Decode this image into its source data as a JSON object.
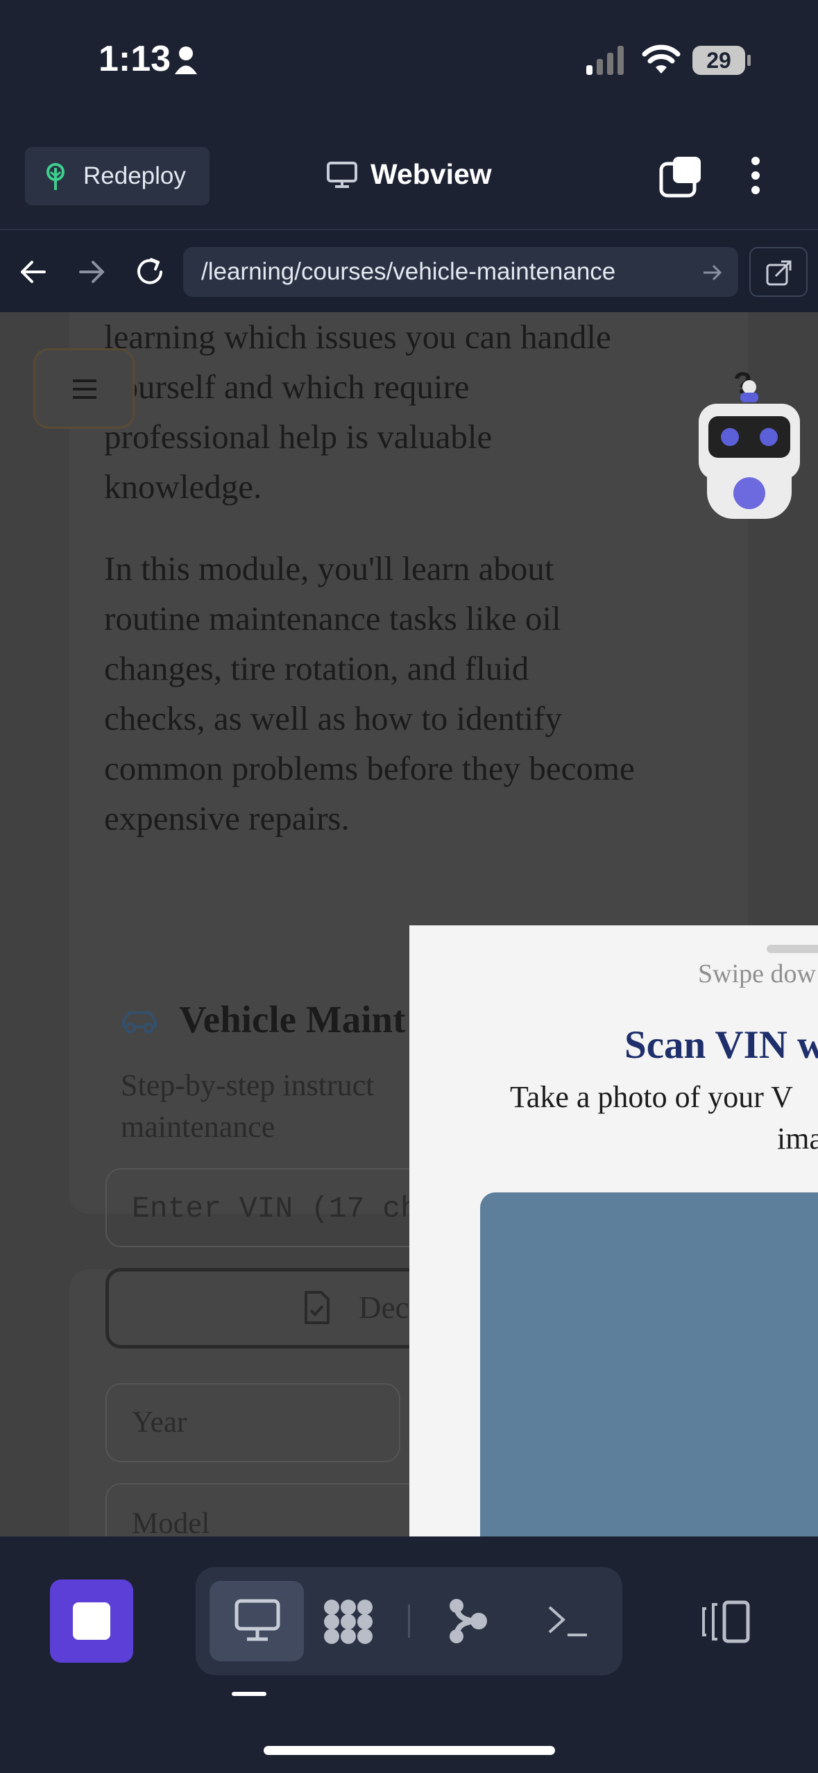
{
  "status_bar": {
    "time": "1:13",
    "battery": "29"
  },
  "header": {
    "redeploy_label": "Redeploy",
    "title": "Webview"
  },
  "url_bar": {
    "url": "/learning/courses/vehicle-maintenance"
  },
  "content": {
    "para1_lines": [
      "learning which issues you can handle",
      "yourself and which require",
      "professional help is valuable",
      "knowledge."
    ],
    "para2_lines": [
      "In this module, you'll learn about",
      "routine maintenance tasks like oil",
      "changes, tire rotation, and fluid",
      "checks, as well as how to identify",
      "common problems before they become",
      "expensive repairs."
    ],
    "help_glyph": "?",
    "tool_title": "Vehicle Maint",
    "tool_desc_lines": [
      "Step-by-step instruct",
      "maintenance"
    ],
    "vin_placeholder": "Enter VIN (17 ch",
    "decode_label": "Dec",
    "year_placeholder": "Year",
    "model_placeholder": "Model"
  },
  "sheet": {
    "swipe_hint": "Swipe dow",
    "title": "Scan VIN w",
    "desc_line1": "Take a photo of your V",
    "desc_line2": "ima",
    "preview_color": "#5d7f9b"
  },
  "icons": [
    "person-icon",
    "signal-icon",
    "wifi-icon",
    "battery-icon",
    "tree-icon",
    "monitor-icon",
    "tabs-icon",
    "more-icon",
    "back-icon",
    "forward-icon",
    "reload-icon",
    "go-arrow-icon",
    "open-external-icon",
    "menu-icon",
    "robot-icon",
    "car-icon",
    "document-check-icon",
    "stop-icon",
    "desktop-icon",
    "grid-icon",
    "flow-icon",
    "terminal-icon",
    "split-view-icon"
  ],
  "colors": {
    "accent": "#5b3fd6",
    "sheet_title": "#1f2f6b",
    "background": "#1c2232",
    "overlay": "#414141"
  }
}
